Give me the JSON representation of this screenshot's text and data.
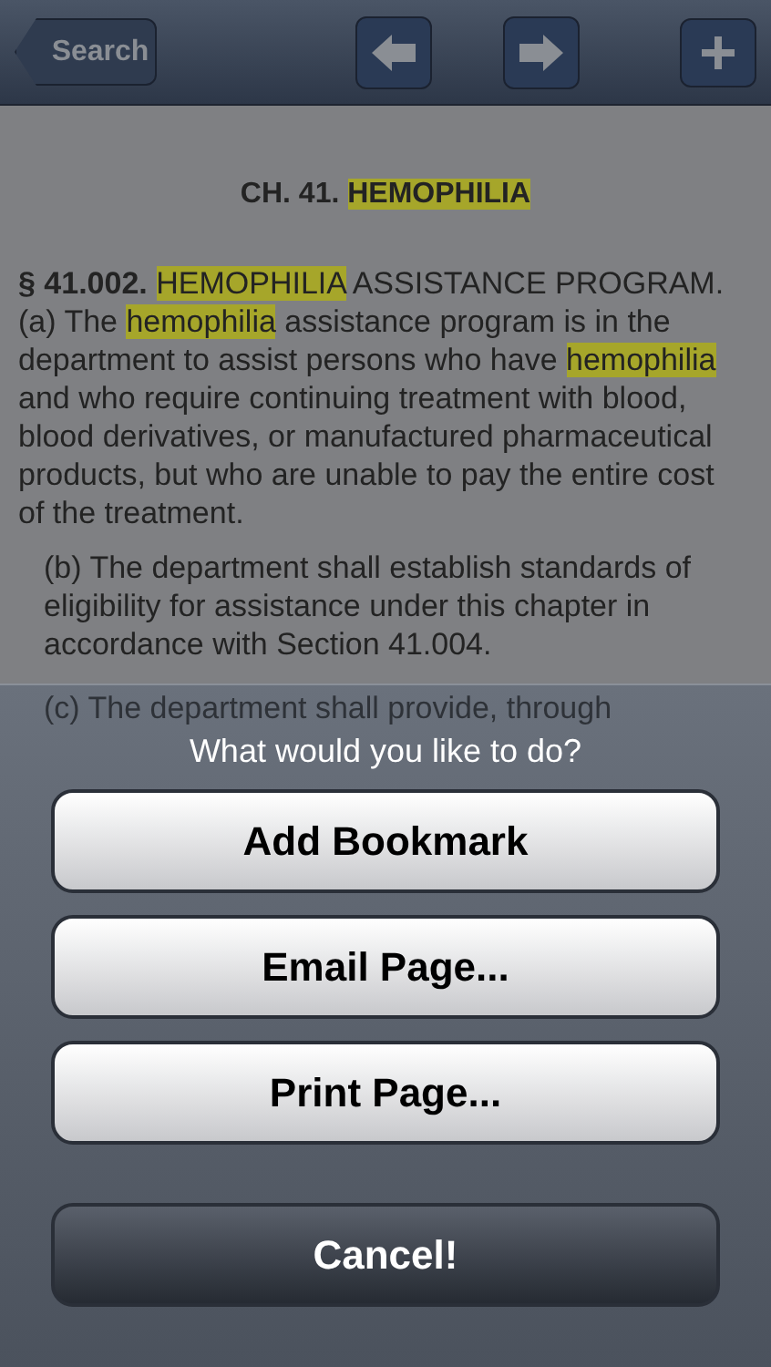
{
  "nav_bar": {
    "back_button": "Search",
    "buttons": [
      {
        "kind": "back"
      },
      {
        "kind": "forward"
      },
      {
        "kind": "add"
      }
    ]
  },
  "document": {
    "title": [
      {
        "text": "CH. 41. ",
        "highlighted": false
      },
      {
        "text": "HEMOPHILIA",
        "highlighted": true
      }
    ],
    "paragraphs": [
      {
        "indent": false,
        "segments": [
          {
            "text": "**§ 41.002.** ",
            "highlighted": false
          },
          {
            "text": "HEMOPHILIA",
            "highlighted": true
          },
          {
            "text": " ASSISTANCE PROGRAM. (a) The ",
            "highlighted": false
          },
          {
            "text": "hemophilia",
            "highlighted": true
          },
          {
            "text": " assistance program is in the department to assist persons who have ",
            "highlighted": false
          },
          {
            "text": "hemophilia",
            "highlighted": true
          },
          {
            "text": " and who require continuing treatment with blood, blood derivatives, or manufactured pharmaceutical products, but who are unable to pay the entire cost of the treatment.",
            "highlighted": false
          }
        ]
      },
      {
        "indent": true,
        "segments": [
          {
            "text": "(b) The department shall establish standards of eligibility for assistance under this chapter in accordance with Section 41.004.",
            "highlighted": false
          }
        ]
      },
      {
        "indent": true,
        "segments": [
          {
            "text": "(c) The department shall provide, through",
            "highlighted": false
          }
        ]
      }
    ]
  },
  "action_sheet": {
    "title": "What would you like to do?",
    "buttons": [
      {
        "label": "Add Bookmark",
        "kind": "default"
      },
      {
        "label": "Email Page...",
        "kind": "default"
      },
      {
        "label": "Print Page...",
        "kind": "default"
      },
      {
        "label": "Cancel!",
        "kind": "cancel"
      }
    ]
  }
}
